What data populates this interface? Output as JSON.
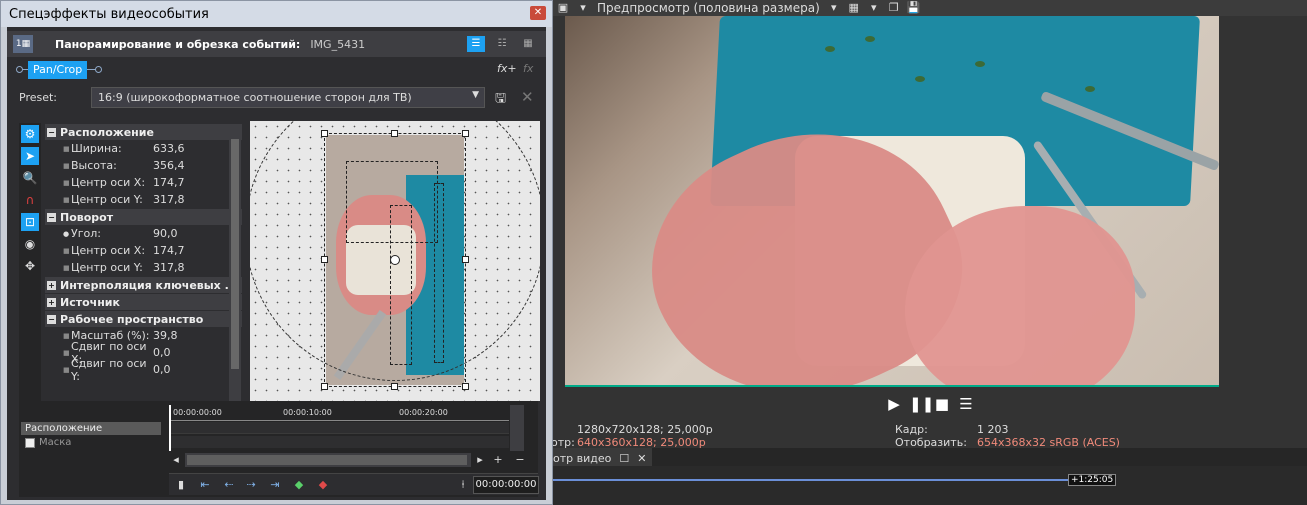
{
  "preview": {
    "toolbar_label": "Предпросмотр (половина размера)",
    "project_props": "1280x720x128; 25,000p",
    "preview_label_suffix": "отр:",
    "preview_props": "640x360x128; 25,000p",
    "frame_label": "Кадр:",
    "frame_value": "1 203",
    "display_label": "Отобразить:",
    "display_value": "654x368x32 sRGB (ACES)",
    "tab_label": "отр видео",
    "timeline_tc": "+1:25:05",
    "colors": {
      "highlight": "#f08a7a",
      "timeline_line": "#6b8fd8",
      "accent": "#1da1f2"
    }
  },
  "fx": {
    "window_title": "Спецэффекты видеособытия",
    "header_name": "Панорамирование и обрезка событий:",
    "header_file": "IMG_5431",
    "chain_chip": "Pan/Crop",
    "preset_label": "Preset:",
    "preset_value": "16:9 (широкоформатное соотношение сторон для ТВ)",
    "sections": {
      "position": {
        "title": "Расположение",
        "rows": [
          {
            "k": "Ширина:",
            "v": "633,6"
          },
          {
            "k": "Высота:",
            "v": "356,4"
          },
          {
            "k": "Центр оси X:",
            "v": "174,7"
          },
          {
            "k": "Центр оси Y:",
            "v": "317,8"
          }
        ]
      },
      "rotation": {
        "title": "Поворот",
        "rows": [
          {
            "k": "Угол:",
            "v": "90,0"
          },
          {
            "k": "Центр оси X:",
            "v": "174,7"
          },
          {
            "k": "Центр оси Y:",
            "v": "317,8"
          }
        ]
      },
      "interp": {
        "title": "Интерполяция ключевых ..."
      },
      "source": {
        "title": "Источник"
      },
      "workspace": {
        "title": "Рабочее пространство",
        "rows": [
          {
            "k": "Масштаб (%):",
            "v": "39,8"
          },
          {
            "k": "Сдвиг по оси X:",
            "v": "0,0"
          },
          {
            "k": "Сдвиг по оси Y:",
            "v": "0,0"
          }
        ]
      }
    },
    "keyframes": {
      "track1": "Расположение",
      "track2": "Маска",
      "ruler": [
        "00:00:00:00",
        "00:00:10:00",
        "00:00:20:00"
      ],
      "timecode": "00:00:00:00"
    }
  }
}
